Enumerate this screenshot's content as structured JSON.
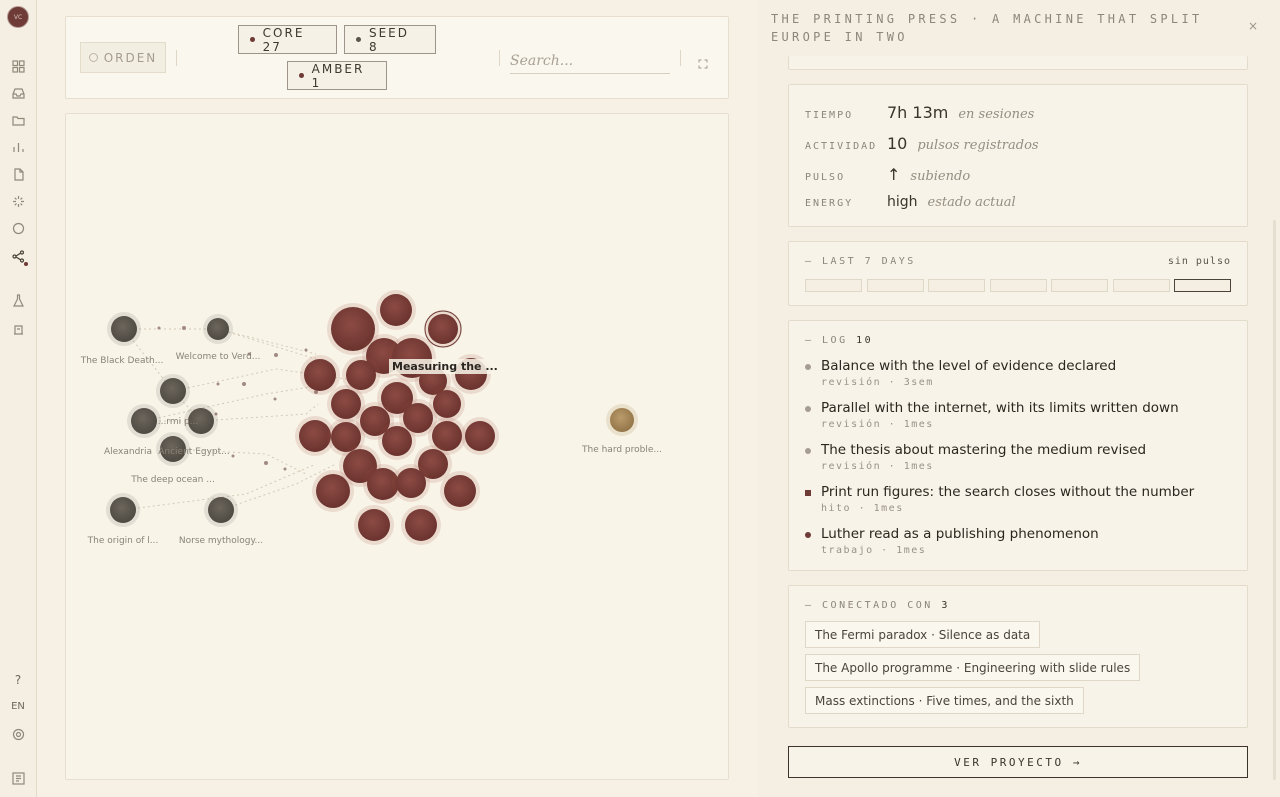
{
  "rail": {
    "avatar_initials": "VC",
    "help": "?",
    "language": "EN",
    "icons": [
      "grid-icon",
      "inbox-icon",
      "folder-icon",
      "chart-icon",
      "document-icon",
      "sparkle-icon",
      "circle-icon",
      "graph-icon",
      "flask-icon",
      "scale-icon",
      "help-icon",
      "language-toggle",
      "settings-icon",
      "panel-icon"
    ]
  },
  "toolbar": {
    "orden_label": "ORDEN",
    "filters": [
      {
        "label": "CORE 27",
        "color": "#6e3b36"
      },
      {
        "label": "SEED 8",
        "color": "#5b544a"
      },
      {
        "label": "AMBER 1",
        "color": "#8a6a3e"
      }
    ],
    "search_placeholder": "Search..."
  },
  "graph": {
    "hover_label": "Measuring the ...",
    "labels": [
      "The Black Death...",
      "Welcome to Verd...",
      "...rmi p...",
      "Alexandria",
      "Ancient Egypt...",
      "The deep ocean ...",
      "The origin of l...",
      "Norse mythology...",
      "The hard proble..."
    ]
  },
  "panel": {
    "title": "THE PRINTING PRESS · A MACHINE THAT SPLIT EUROPE IN TWO",
    "close": "×",
    "stats": [
      {
        "key": "TIEMPO",
        "value": "7h 13m",
        "note": "en sesiones"
      },
      {
        "key": "ACTIVIDAD",
        "value": "10",
        "note": "pulsos registrados"
      },
      {
        "key": "PULSO",
        "value": "↑",
        "note": "subiendo"
      },
      {
        "key": "ENERGY",
        "value": "high",
        "note": "estado actual"
      }
    ],
    "last7": {
      "heading": "— LAST 7 DAYS",
      "status": "sin pulso"
    },
    "log": {
      "heading": "— LOG",
      "count": "10",
      "items": [
        {
          "text": "Balance with the level of evidence declared",
          "meta": "revisión · 3sem",
          "color": "#a69d92",
          "shape": "circle"
        },
        {
          "text": "Parallel with the internet, with its limits written down",
          "meta": "revisión · 1mes",
          "color": "#a69d92",
          "shape": "circle"
        },
        {
          "text": "The thesis about mastering the medium revised",
          "meta": "revisión · 1mes",
          "color": "#a69d92",
          "shape": "circle"
        },
        {
          "text": "Print run figures: the search closes without the number",
          "meta": "hito · 1mes",
          "color": "#6e3b36",
          "shape": "square"
        },
        {
          "text": "Luther read as a publishing phenomenon",
          "meta": "trabajo · 1mes",
          "color": "#6e3b36",
          "shape": "circle"
        }
      ]
    },
    "connected": {
      "heading": "— CONECTADO CON",
      "count": "3",
      "items": [
        "The Fermi paradox · Silence as data",
        "The Apollo programme · Engineering with slide rules",
        "Mass extinctions · Five times, and the sixth"
      ]
    },
    "ver_proyecto": "VER PROYECTO →"
  }
}
